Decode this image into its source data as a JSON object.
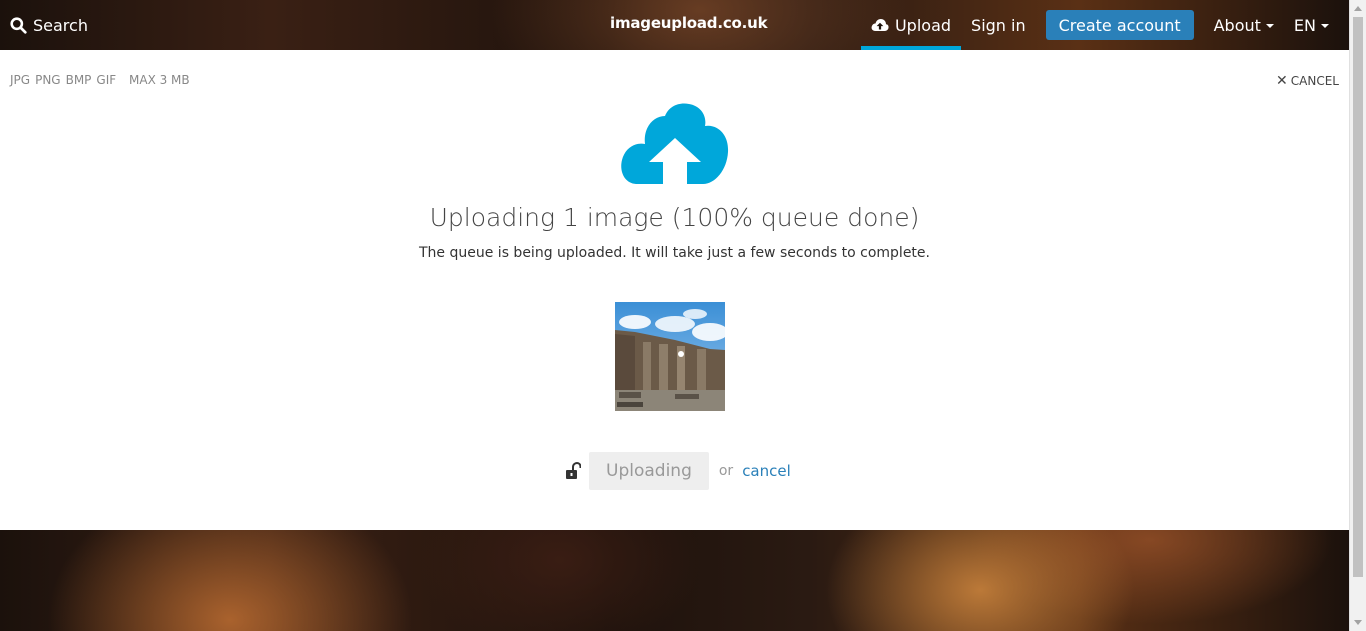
{
  "header": {
    "search_label": "Search",
    "logo": "imageupload.co.uk",
    "nav": {
      "upload": "Upload",
      "sign_in": "Sign in",
      "create_account": "Create account",
      "about": "About",
      "language": "EN"
    }
  },
  "panel": {
    "formats": [
      "JPG",
      "PNG",
      "BMP",
      "GIF"
    ],
    "max_size": "MAX 3 MB",
    "cancel_top": "CANCEL",
    "title": "Uploading 1 image (100% queue done)",
    "subtitle": "The queue is being uploaded. It will take just a few seconds to complete.",
    "uploading_button": "Uploading",
    "or_text": "or",
    "cancel_link": "cancel"
  },
  "colors": {
    "accent": "#00a7da",
    "button_blue": "#2a80b9"
  }
}
